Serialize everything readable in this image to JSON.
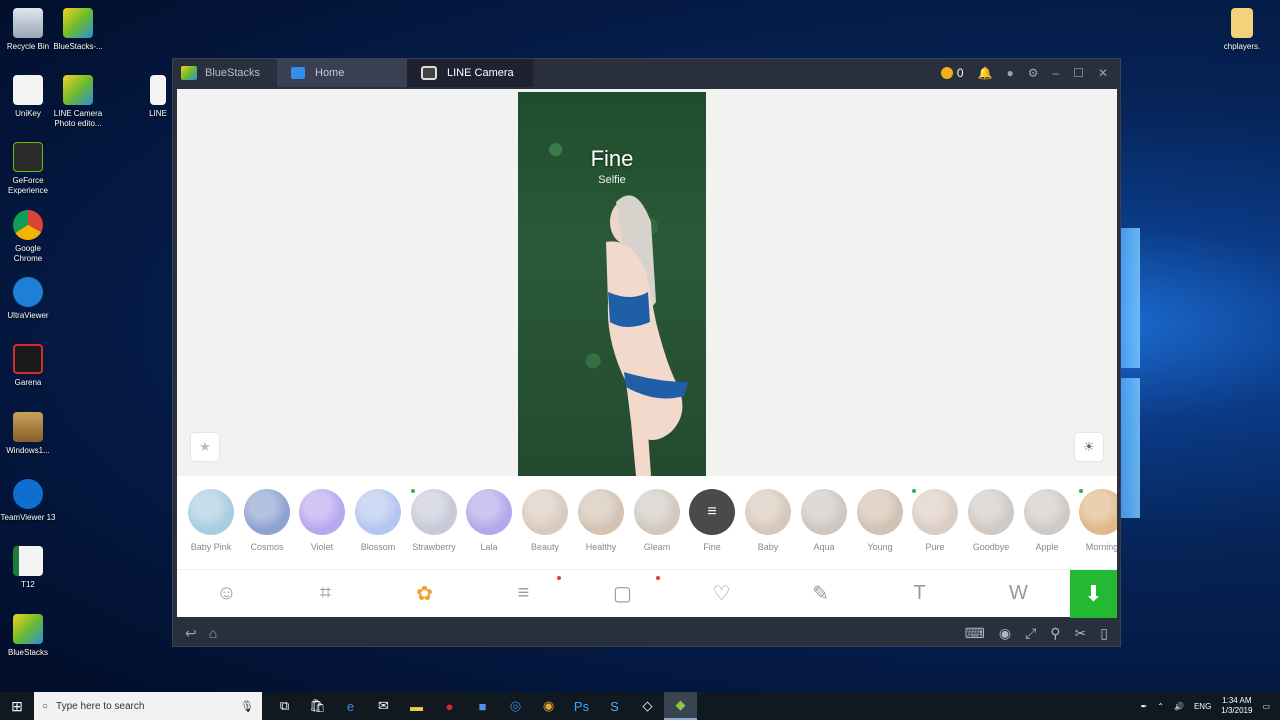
{
  "desktop": {
    "left_icons": [
      {
        "label": "Recycle Bin"
      },
      {
        "label": "BlueStacks-..."
      },
      {
        "label": "UniKey"
      },
      {
        "label": "LINE Camera Photo edito..."
      },
      {
        "label": "GeForce Experience"
      },
      {
        "label": "Google Chrome"
      },
      {
        "label": "UltraViewer"
      },
      {
        "label": "Garena"
      },
      {
        "label": "Windows1..."
      },
      {
        "label": "TeamViewer 13"
      },
      {
        "label": "T12"
      },
      {
        "label": "BlueStacks"
      }
    ],
    "partial_icon_label": "LINE",
    "right_icon": {
      "label": "chplayers."
    }
  },
  "bluestacks": {
    "brand": "BlueStacks",
    "tabs": [
      {
        "label": "Home"
      },
      {
        "label": "LINE Camera"
      }
    ],
    "coins": "0"
  },
  "photo": {
    "title": "Fine",
    "subtitle": "Selfie"
  },
  "filters": [
    {
      "label": "Baby Pink",
      "color": "#a9cde0"
    },
    {
      "label": "Cosmos",
      "color": "#8da3d0"
    },
    {
      "label": "Violet",
      "color": "#b8a8ef"
    },
    {
      "label": "Blossom",
      "color": "#b5c6ee"
    },
    {
      "label": "Strawberry",
      "color": "#c7c9d8"
    },
    {
      "label": "Lala",
      "color": "#b3a9ea"
    },
    {
      "label": "Beauty",
      "color": "#d9cabd"
    },
    {
      "label": "Healthy",
      "color": "#d4c3b3"
    },
    {
      "label": "Gleam",
      "color": "#d1c9c1"
    },
    {
      "label": "Fine",
      "color": "#4a4a4a"
    },
    {
      "label": "Baby",
      "color": "#d7c8bb"
    },
    {
      "label": "Aqua",
      "color": "#cfc8c2"
    },
    {
      "label": "Young",
      "color": "#d3c1b2"
    },
    {
      "label": "Pure",
      "color": "#dccdc2"
    },
    {
      "label": "Goodbye",
      "color": "#d1c9c3"
    },
    {
      "label": "Apple",
      "color": "#cfcac6"
    },
    {
      "label": "Morning",
      "color": "#e0b88a"
    }
  ],
  "taskbar": {
    "search_placeholder": "Type here to search",
    "lang": "ENG",
    "time": "1:34 AM",
    "date": "1/3/2019"
  }
}
